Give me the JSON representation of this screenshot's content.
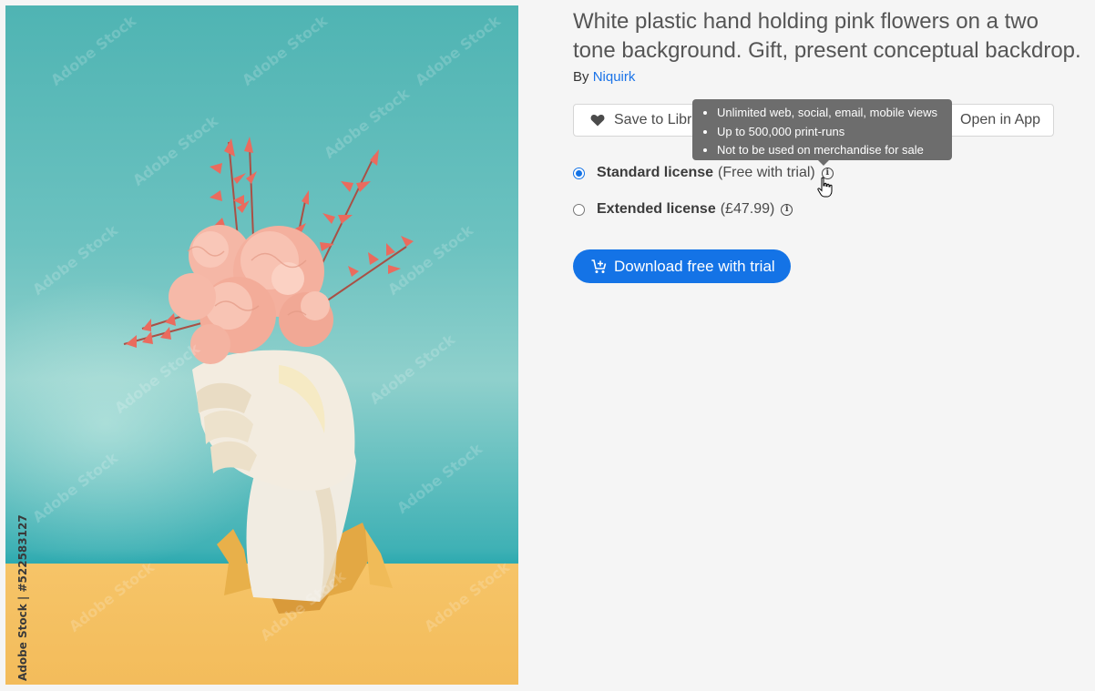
{
  "image": {
    "stock_id_label": "Adobe Stock | #522583127",
    "watermark_text": "Adobe Stock"
  },
  "asset": {
    "title": "White plastic hand holding pink flowers on a two tone background. Gift, present conceptual backdrop.",
    "by_prefix": "By",
    "author": "Niquirk"
  },
  "actions": {
    "save_label": "Save to Libra",
    "open_label": "Open in App"
  },
  "tooltip": {
    "items": [
      "Unlimited web, social, email, mobile views",
      "Up to 500,000 print-runs",
      "Not to be used on merchandise for sale"
    ]
  },
  "licenses": [
    {
      "name": "Standard license",
      "detail": "(Free with trial)",
      "selected": true
    },
    {
      "name": "Extended license",
      "detail": "(£47.99)",
      "selected": false
    }
  ],
  "download": {
    "label": "Download free with trial"
  },
  "colors": {
    "accent": "#1473e6",
    "link": "#1a73e8",
    "tooltip_bg": "#6d6d6d",
    "teal_backdrop": "#5dbcbb",
    "yellow_floor": "#f5c163"
  },
  "icons": {
    "save": "heart-icon",
    "info": "info-icon",
    "download": "cart-plus-icon",
    "cursor": "hand-pointer-icon"
  }
}
